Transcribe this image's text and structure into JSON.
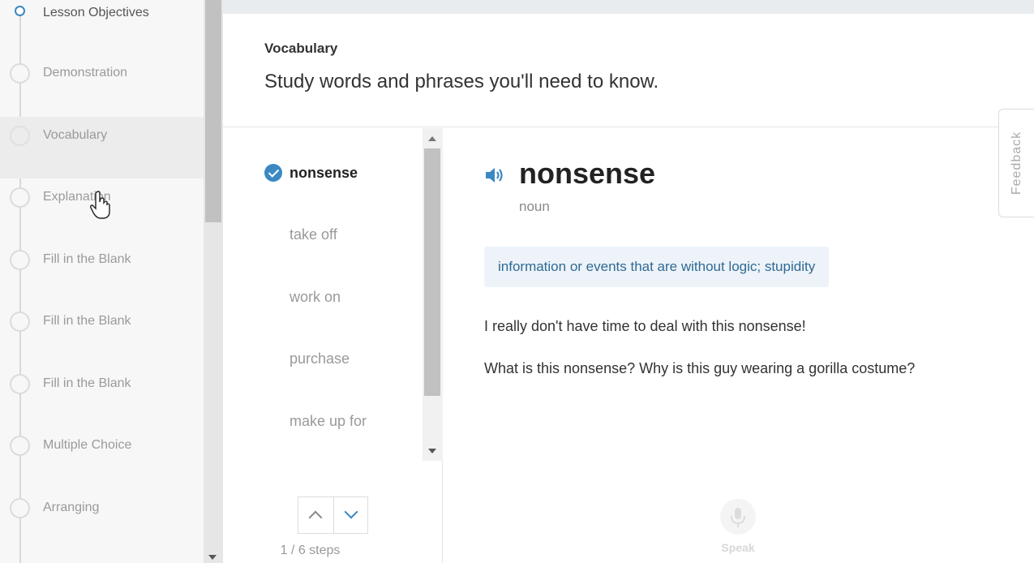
{
  "sidebar": {
    "items": [
      {
        "label": "Lesson Objectives"
      },
      {
        "label": "Demonstration"
      },
      {
        "label": "Vocabulary"
      },
      {
        "label": "Explanation"
      },
      {
        "label": "Fill in the Blank"
      },
      {
        "label": "Fill in the Blank"
      },
      {
        "label": "Fill in the Blank"
      },
      {
        "label": "Multiple Choice"
      },
      {
        "label": "Arranging"
      }
    ],
    "current_index": 0,
    "active_index": 2
  },
  "header": {
    "section": "Vocabulary",
    "subtitle": "Study words and phrases you'll need to know."
  },
  "wordlist": {
    "words": [
      "nonsense",
      "take off",
      "work on",
      "purchase",
      "make up for"
    ],
    "selected_index": 0,
    "steps_text": "1 / 6 steps"
  },
  "detail": {
    "headword": "nonsense",
    "part_of_speech": "noun",
    "definition": "information or events that are without logic; stupidity",
    "examples": [
      "I really don't have time to deal with this nonsense!",
      "What is this nonsense? Why is this guy wearing a gorilla costume?"
    ],
    "speak_label": "Speak"
  },
  "feedback": {
    "label": "Feedback"
  },
  "colors": {
    "accent": "#3b88c3",
    "definition_bg": "#edf3f9",
    "definition_text": "#2f6a93"
  }
}
